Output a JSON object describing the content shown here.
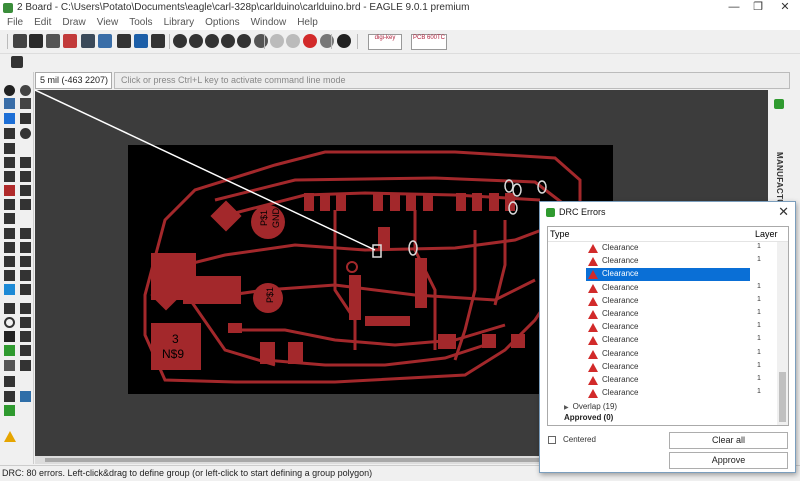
{
  "window": {
    "title": "2 Board - C:\\Users\\Potato\\Documents\\eagle\\carl-328p\\carlduino\\carlduino.brd - EAGLE 9.0.1 premium",
    "controls": [
      "—",
      "❐",
      "✕"
    ]
  },
  "menu": {
    "items": [
      "File",
      "Edit",
      "Draw",
      "View",
      "Tools",
      "Library",
      "Options",
      "Window",
      "Help"
    ]
  },
  "toolbar": {
    "brand1": "digi-key",
    "brand2": "PCB 600TC"
  },
  "command": {
    "coordinate": "5 mil (-463 2207)",
    "placeholder": "Click or press Ctrl+L key to activate command line mode"
  },
  "rightbar": {
    "label": "MANUFACTURING"
  },
  "pcb": {
    "labels": [
      "GND",
      "P$1",
      "P$1",
      "3",
      "N$9"
    ]
  },
  "status": {
    "text": "DRC: 80 errors. Left-click&drag to define group (or left-click to start defining a group polygon)"
  },
  "drc": {
    "title": "DRC Errors",
    "col_type": "Type",
    "col_layer": "Layer",
    "errors": [
      {
        "type": "Clearance",
        "layer": "1",
        "selected": false
      },
      {
        "type": "Clearance",
        "layer": "1",
        "selected": false
      },
      {
        "type": "Clearance",
        "layer": "1",
        "selected": true
      },
      {
        "type": "Clearance",
        "layer": "1",
        "selected": false
      },
      {
        "type": "Clearance",
        "layer": "1",
        "selected": false
      },
      {
        "type": "Clearance",
        "layer": "1",
        "selected": false
      },
      {
        "type": "Clearance",
        "layer": "1",
        "selected": false
      },
      {
        "type": "Clearance",
        "layer": "1",
        "selected": false
      },
      {
        "type": "Clearance",
        "layer": "1",
        "selected": false
      },
      {
        "type": "Clearance",
        "layer": "1",
        "selected": false
      },
      {
        "type": "Clearance",
        "layer": "1",
        "selected": false
      },
      {
        "type": "Clearance",
        "layer": "1",
        "selected": false
      }
    ],
    "group_overlap": "Overlap (19)",
    "group_approved": "Approved (0)",
    "centered_label": "Centered",
    "clear_all": "Clear all",
    "approve": "Approve"
  },
  "colors": {
    "board": "#000000",
    "copper": "#a3282b",
    "canvas": "#3c3c3c",
    "selection": "#0a6fd6",
    "error": "#d22a2a"
  }
}
